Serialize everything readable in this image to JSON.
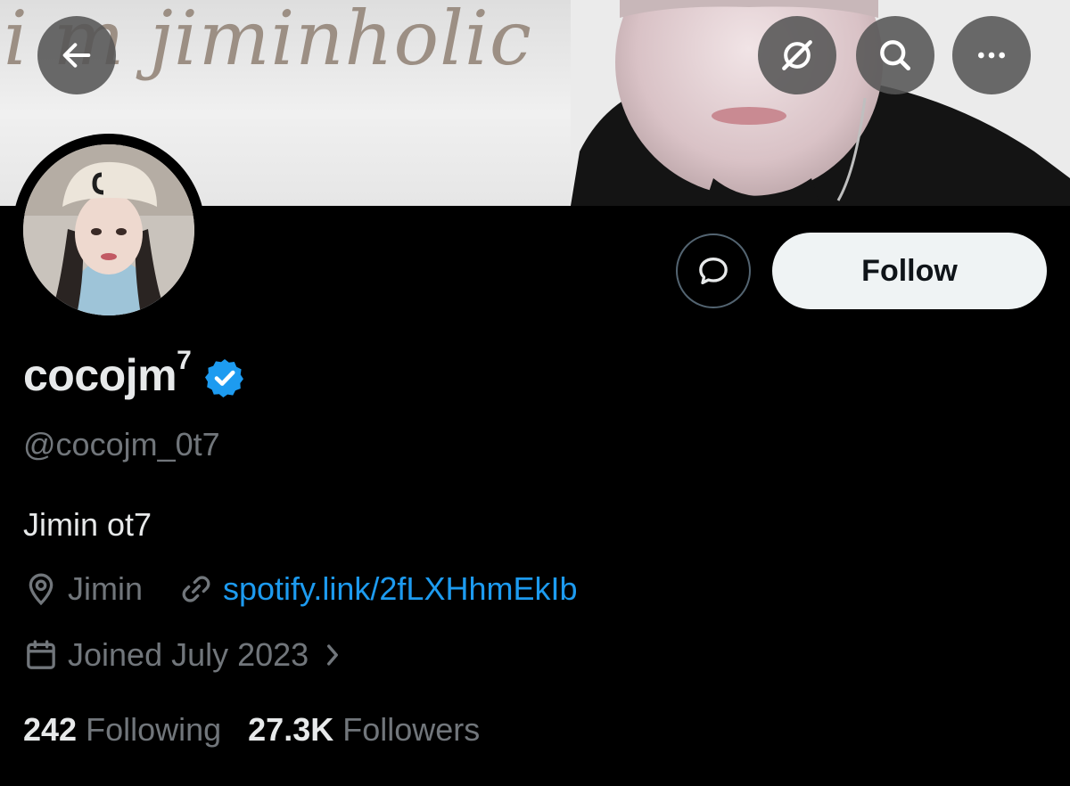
{
  "banner": {
    "text": "i m jiminholic"
  },
  "nav": {
    "back_icon": "arrow-left-icon",
    "grok_icon": "grok-icon",
    "search_icon": "search-icon",
    "more_icon": "more-dots-icon"
  },
  "actions": {
    "message_icon": "message-bubble-icon",
    "follow_label": "Follow"
  },
  "profile": {
    "display_name": "cocojm",
    "display_name_suffix": "7",
    "verified_color": "#1d9bf0",
    "handle": "@cocojm_0t7",
    "bio": "Jimin ot7",
    "location": "Jimin",
    "link": "spotify.link/2fLXHhmEkIb",
    "joined": "Joined July 2023"
  },
  "stats": {
    "following_count": "242",
    "following_label": "Following",
    "followers_count": "27.3K",
    "followers_label": "Followers"
  },
  "colors": {
    "background": "#000000",
    "text_primary": "#e7e9ea",
    "text_secondary": "#71767b",
    "link": "#1d9bf0",
    "follow_bg": "#eff3f4"
  }
}
